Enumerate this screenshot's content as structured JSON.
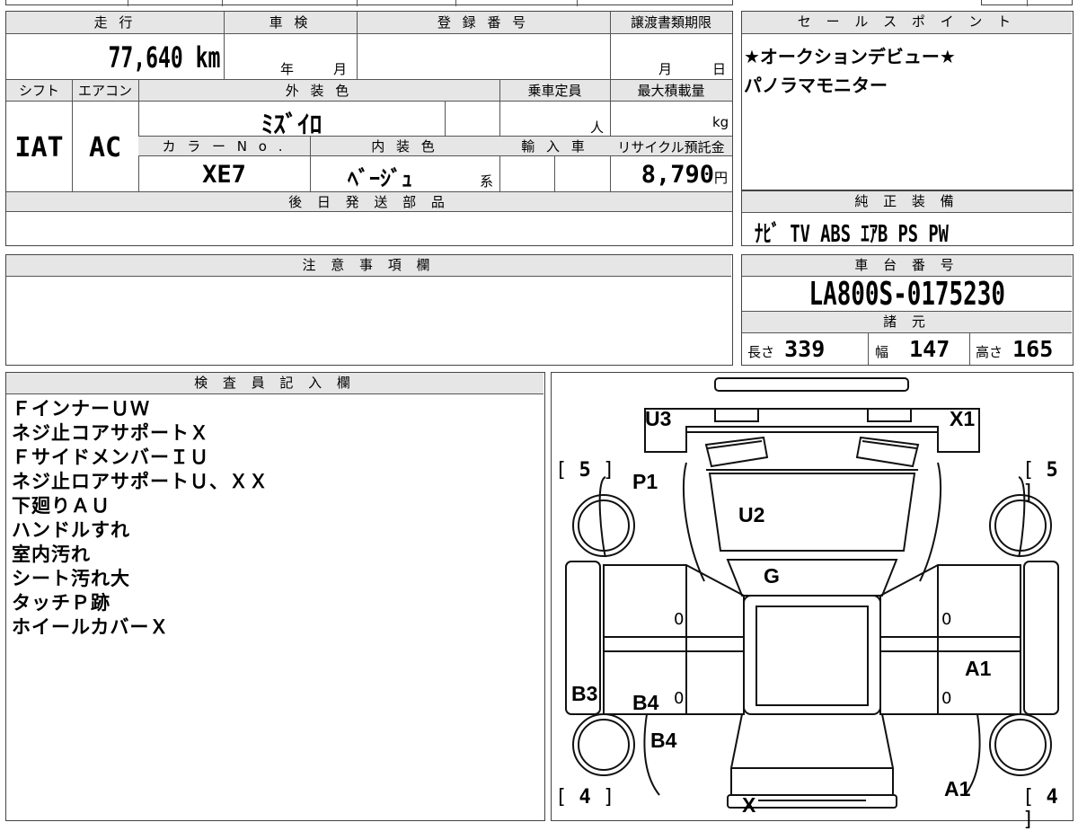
{
  "vehicle": {
    "mileage_label": "走 行",
    "mileage_value": "77,640",
    "mileage_unit": "km",
    "shaken_label": "車 検",
    "shaken_year": "年",
    "shaken_month": "月",
    "reg_label": "登 録 番 号",
    "transfer_label": "譲渡書類期限",
    "transfer_month": "月",
    "transfer_day": "日",
    "shift_label": "シフト",
    "shift_value": "IAT",
    "ac_label": "エアコン",
    "ac_value": "AC",
    "ext_color_label": "外 装 色",
    "ext_color_value": "ﾐｽﾞｲﾛ",
    "capacity_label": "乗車定員",
    "capacity_unit": "人",
    "maxload_label": "最大積載量",
    "maxload_unit": "kg",
    "color_no_label": "カ ラ ー N o .",
    "color_no_value": "XE7",
    "int_color_label": "内 装 色",
    "int_color_value": "ﾍﾞｰｼﾞｭ",
    "int_color_suffix": "系",
    "import_label": "輸 入 車",
    "recycle_label": "リサイクル預託金",
    "recycle_value": "8,790",
    "recycle_unit": "円",
    "later_parts_label": "後 日 発 送 部 品"
  },
  "sales_point": {
    "label": "セ ー ル ス ポ イ ン ト",
    "lines": [
      "★オークションデビュー★",
      "パノラマモニター"
    ]
  },
  "genuine_equipment": {
    "label": "純 正 装 備",
    "value": "ﾅﾋﾞ TV ABS ｴｱB PS PW"
  },
  "notes": {
    "label": "注 意 事 項 欄"
  },
  "chassis": {
    "label": "車 台 番 号",
    "value": "LA800S-0175230",
    "specs_label": "諸 元",
    "length_label": "長さ",
    "length_value": "339",
    "width_label": "幅",
    "width_value": "147",
    "height_label": "高さ",
    "height_value": "165"
  },
  "inspector": {
    "label": "検 査 員 記 入 欄",
    "lines": [
      "ＦインナーＵＷ",
      "ネジ止コアサポートＸ",
      "ＦサイドメンバーＩＵ",
      "ネジ止ロアサポートＵ、ＸＸ",
      "下廻りＡＵ",
      "ハンドルすれ",
      "室内汚れ",
      "シート汚れ大",
      "タッチＰ跡",
      "ホイールカバーＸ"
    ]
  },
  "diagram": {
    "u3": "U3",
    "x1": "X1",
    "p1": "P1",
    "u2": "U2",
    "g": "G",
    "a1_mid": "A1",
    "b3": "B3",
    "b4_a": "B4",
    "b4_b": "B4",
    "a1_bottom": "A1",
    "x_bottom": "X",
    "zero_1": "0",
    "zero_2": "0",
    "zero_3": "0",
    "zero_4": "0",
    "tire_fl": "5",
    "tire_fr": "5",
    "tire_rl": "4",
    "tire_rr": "4"
  }
}
